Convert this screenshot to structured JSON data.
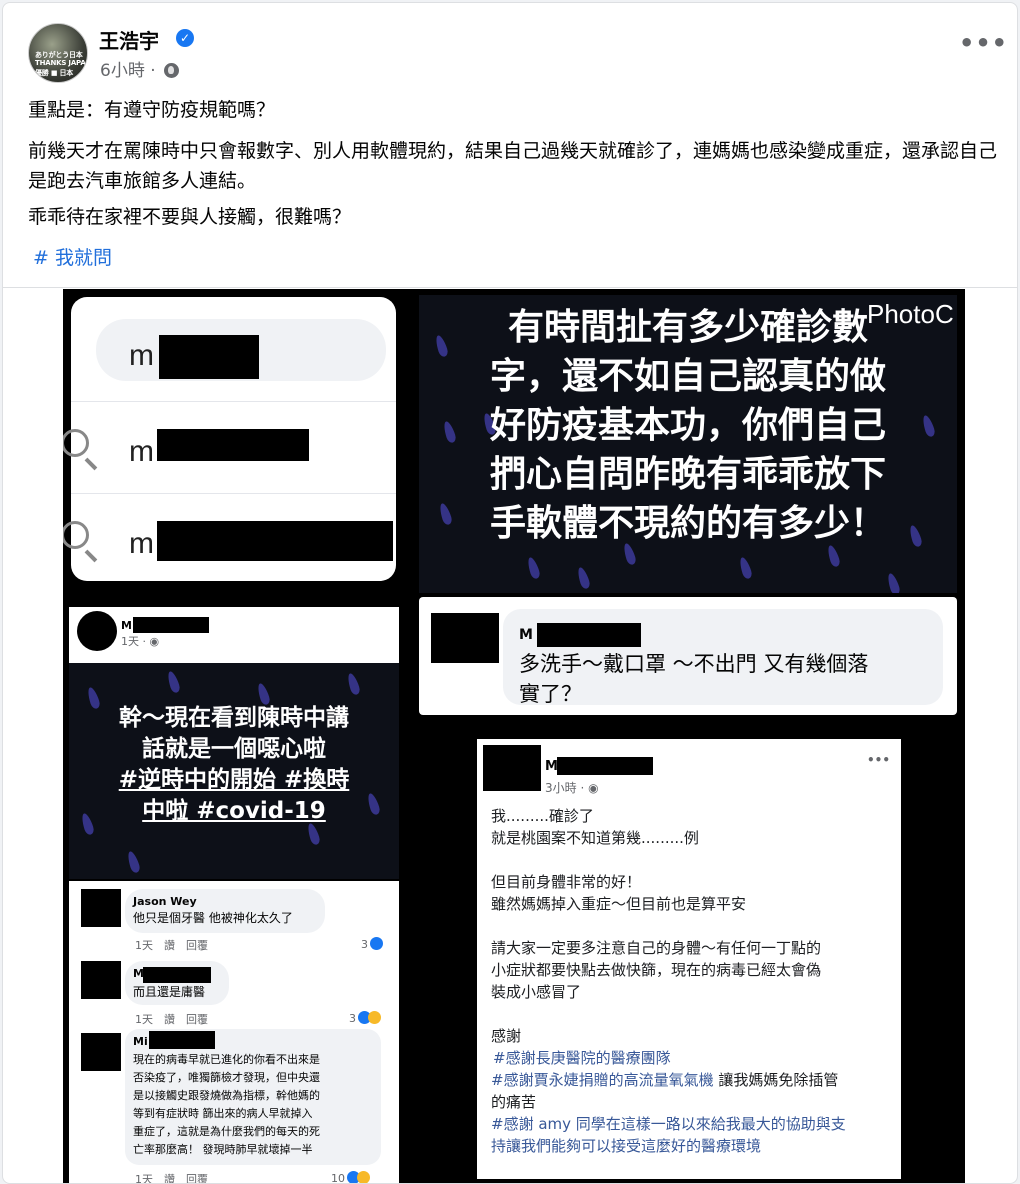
{
  "post": {
    "author": "王浩宇",
    "verified_icon": "✓",
    "time": "6小時 ·",
    "avatar_lines": [
      "ありがとう日本",
      "THANKS JAPAN",
      "優勝 ■ 日本"
    ],
    "more": "•••",
    "paragraphs": [
      "重點是：有遵守防疫規範嗎？",
      "前幾天才在罵陳時中只會報數字、別人用軟體現約，結果自己過幾天就確診了，連媽媽也感染變成重症，還承認自己是跑去汽車旅館多人連結。",
      "乖乖待在家裡不要與人接觸，很難嗎？"
    ],
    "hashtag": "# 我就問"
  },
  "collage": {
    "search_results": [
      "m",
      "m",
      "m"
    ],
    "top_right_lines": [
      "有時間扯有多少確診數",
      "字，還不如自己認真的做",
      "好防疫基本功，你們自己",
      "捫心自問昨晚有乖乖放下",
      "手軟體不現約的有多少！"
    ],
    "watermark": "PhotoC",
    "left_post": {
      "name": "M",
      "time": "1天 · ◉",
      "lines": [
        "幹～現在看到陳時中講",
        "話就是一個噁心啦",
        "#逆時中的開始 #換時",
        "中啦 #covid-19"
      ]
    },
    "right_comment": {
      "name": "M",
      "lines": [
        "多洗手～戴口罩 ～不出門 又有幾個落",
        "實了？"
      ]
    },
    "comments": [
      {
        "name": "Jason Wey",
        "text": "他只是個牙醫 他被神化太久了",
        "actions": "1天　讚　回覆",
        "reacts": "3"
      },
      {
        "name": "M",
        "text": "而且還是庸醫",
        "actions": "1天　讚　回覆",
        "reacts": "3"
      },
      {
        "name": "Mi",
        "lines": [
          "現在的病毒早就已進化的你看不出來是",
          "否染疫了，唯獨篩檢才發現，但中央還",
          "是以接觸史跟發燒做為指標，幹他媽的",
          "等到有症狀時 篩出來的病人早就掉入",
          "重症了，這就是為什麼我們的每天的死",
          "亡率那麼高！ 發現時肺早就壞掉一半"
        ],
        "actions": "1天　讚　回覆",
        "reacts": "10"
      }
    ],
    "confirm_post": {
      "name": "M",
      "time": "3小時 · ◉",
      "more": "•••",
      "lines": [
        "我.........確診了",
        "就是桃園案不知道第幾.........例",
        "",
        "但目前身體非常的好！",
        "雖然媽媽掉入重症～但目前也是算平安",
        "",
        "請大家一定要多注意自己的身體～有任何一丁點的",
        "小症狀都要快點去做快篩，現在的病毒已經太會偽",
        "裝成小感冒了",
        "",
        "感謝"
      ],
      "hashtags": [
        "#感謝長庚醫院的醫療團隊",
        "#感謝賈永婕捐贈的高流量氧氣機",
        "#感謝 amy 同學在這樣一路以來給我最大的協助與支",
        "持讓我們能夠可以接受這麼好的醫療環境"
      ],
      "hashtag_tail_1": " 讓我媽媽免除插管",
      "hashtag_tail_1b": "的痛苦"
    }
  }
}
